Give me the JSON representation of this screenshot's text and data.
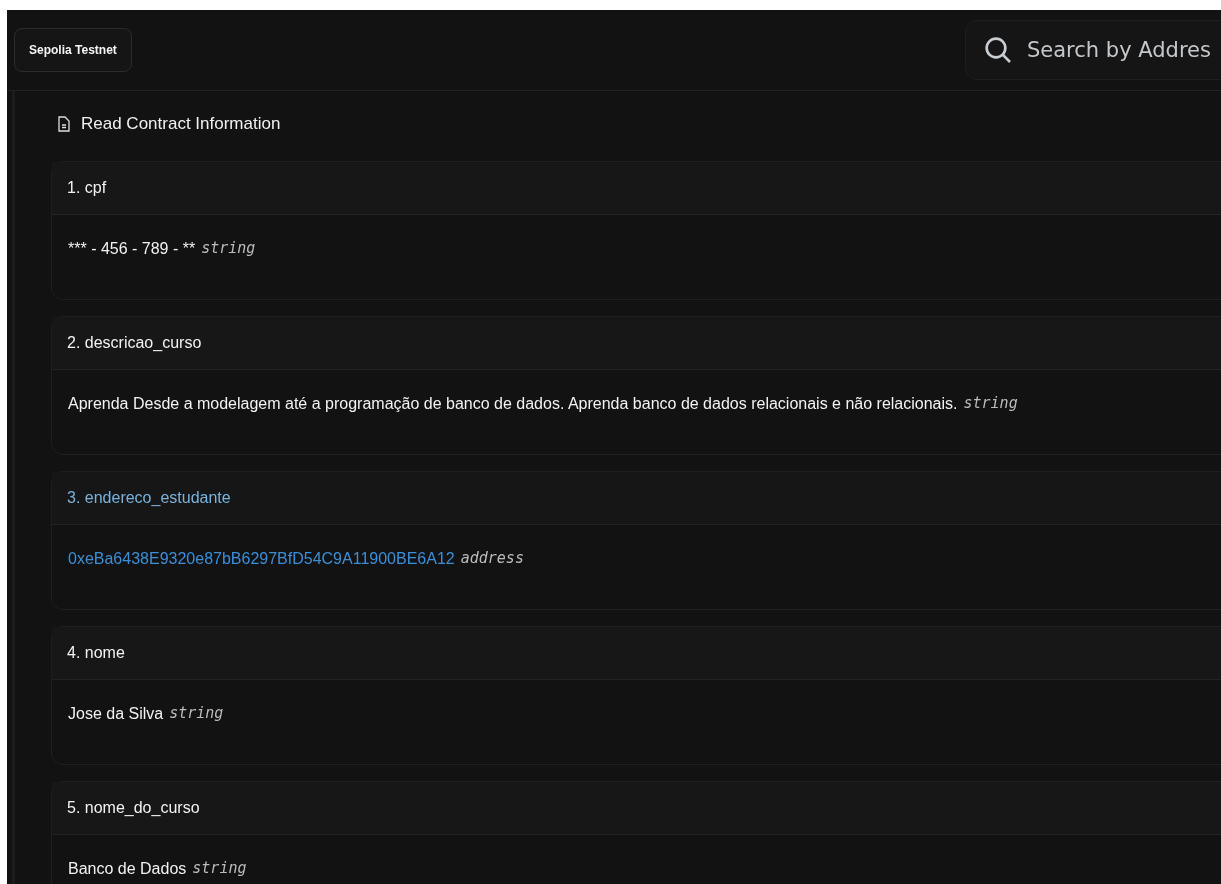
{
  "network_button": "Sepolia Testnet",
  "search": {
    "placeholder": "Search by Addres"
  },
  "section_title": "Read Contract Information",
  "fields": [
    {
      "label": "1. cpf",
      "value": "*** - 456 - 789 - **",
      "type": "string",
      "kind": "text",
      "hovered": false
    },
    {
      "label": "2. descricao_curso",
      "value": "Aprenda Desde a modelagem até a programação de banco de dados. Aprenda banco de dados relacionais e não relacionais.",
      "type": "string",
      "kind": "text",
      "hovered": false
    },
    {
      "label": "3. endereco_estudante",
      "value": "0xeBa6438E9320e87bB6297BfD54C9A11900BE6A12",
      "type": "address",
      "kind": "address",
      "hovered": true
    },
    {
      "label": "4. nome",
      "value": "Jose da Silva",
      "type": "string",
      "kind": "text",
      "hovered": false
    },
    {
      "label": "5. nome_do_curso",
      "value": "Banco de Dados",
      "type": "string",
      "kind": "text",
      "hovered": false
    }
  ]
}
